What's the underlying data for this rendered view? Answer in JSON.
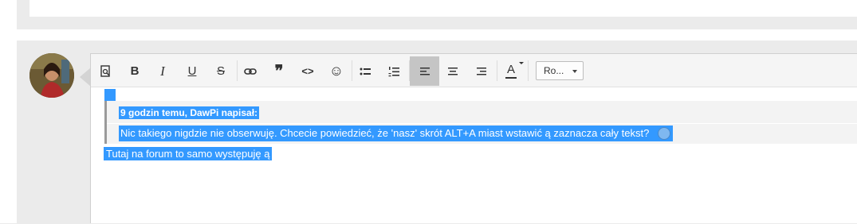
{
  "toolbar": {
    "buttons": [
      {
        "name": "preview-icon"
      },
      {
        "name": "bold-icon",
        "label": "B"
      },
      {
        "name": "italic-icon",
        "label": "I"
      },
      {
        "name": "underline-icon",
        "label": "U"
      },
      {
        "name": "strikethrough-icon",
        "label": "S"
      },
      {
        "name": "link-icon"
      },
      {
        "name": "quote-icon",
        "label": "❞"
      },
      {
        "name": "code-icon",
        "label": "<>"
      },
      {
        "name": "emoji-icon",
        "label": "☺"
      },
      {
        "name": "bullet-list-icon"
      },
      {
        "name": "numbered-list-icon"
      },
      {
        "name": "align-left-icon"
      },
      {
        "name": "align-center-icon"
      },
      {
        "name": "align-right-icon"
      },
      {
        "name": "text-color-icon",
        "label": "A"
      }
    ],
    "font_select": "Ro...",
    "active_button": "align-left-icon"
  },
  "quote": {
    "header": "9 godzin temu, DawPi napisał:",
    "body": "Nic takiego nigdzie nie obserwuję. Chcecie powiedzieć, że 'nasz' skrót ALT+A miast wstawić ą zaznacza cały tekst?"
  },
  "reply_text": "Tutaj na forum to samo występuję ą",
  "colors": {
    "selection": "#3399ff",
    "toolbar_bg": "#f5f5f5",
    "active_bg": "#c5c5c5",
    "page_bg": "#ebebeb"
  }
}
